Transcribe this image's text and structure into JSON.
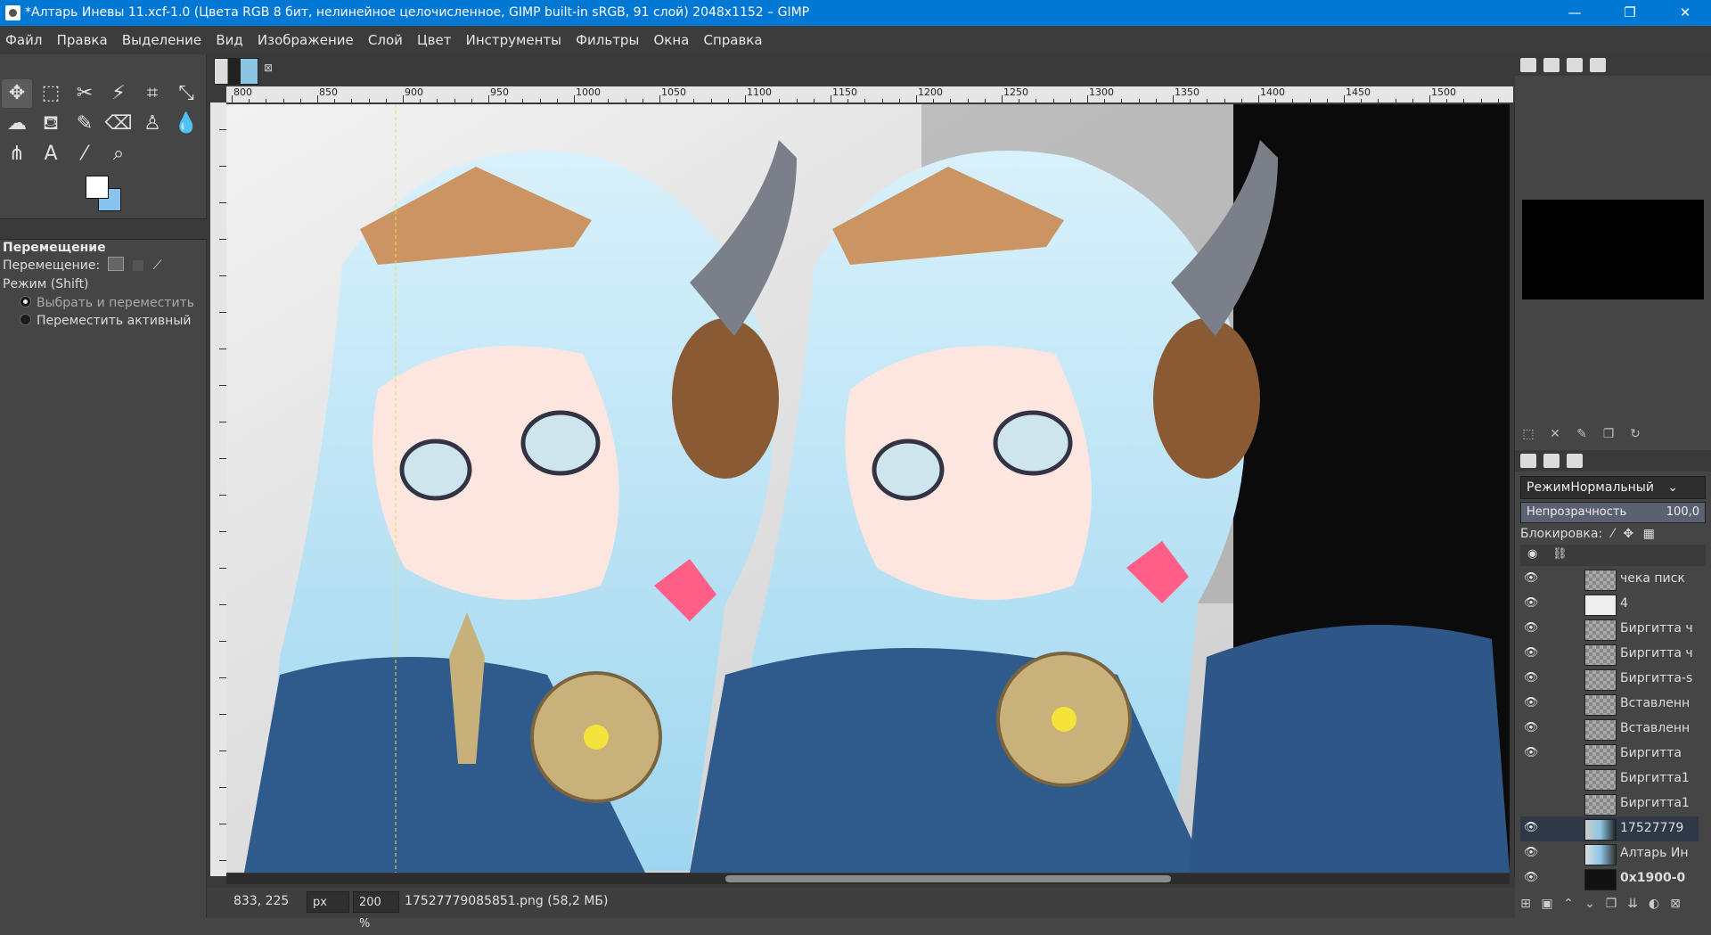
{
  "window": {
    "title": "*Алтарь Иневы 11.xcf-1.0 (Цвета RGB 8 бит, нелинейное целочисленное, GIMP built-in sRGB, 91 слой) 2048x1152 – GIMP",
    "minimize": "—",
    "restore": "❐",
    "close": "✕"
  },
  "menu": [
    "Файл",
    "Правка",
    "Выделение",
    "Вид",
    "Изображение",
    "Слой",
    "Цвет",
    "Инструменты",
    "Фильтры",
    "Окна",
    "Справка"
  ],
  "toolbox": {
    "tools": [
      {
        "name": "move-tool-icon",
        "glyph": "✥"
      },
      {
        "name": "rect-select-icon",
        "glyph": "⬚"
      },
      {
        "name": "scissors-select-icon",
        "glyph": "✂"
      },
      {
        "name": "fuzzy-select-icon",
        "glyph": "⚡"
      },
      {
        "name": "crop-icon",
        "glyph": "⌗"
      },
      {
        "name": "transform-icon",
        "glyph": "⤡"
      },
      {
        "name": "warp-icon",
        "glyph": "☁"
      },
      {
        "name": "bucket-fill-icon",
        "glyph": "⛾"
      },
      {
        "name": "paintbrush-icon",
        "glyph": "✎"
      },
      {
        "name": "eraser-icon",
        "glyph": "⌫"
      },
      {
        "name": "clone-icon",
        "glyph": "♙"
      },
      {
        "name": "smudge-icon",
        "glyph": "💧"
      },
      {
        "name": "paths-icon",
        "glyph": "⋔"
      },
      {
        "name": "text-tool-icon",
        "glyph": "A"
      },
      {
        "name": "color-picker-icon",
        "glyph": "⁄"
      },
      {
        "name": "zoom-icon",
        "glyph": "⌕"
      }
    ],
    "fg_color": "#ffffff",
    "bg_color": "#87c5f0"
  },
  "tool_options": {
    "title": "Перемещение",
    "move_label": "Перемещение:",
    "mode_label": "Режим (Shift)",
    "options": [
      "Выбрать и переместить",
      "Переместить активный"
    ]
  },
  "canvas": {
    "image_tab_close": "⊠",
    "ruler_labels": [
      "800",
      "850",
      "900",
      "950",
      "1000",
      "1050",
      "1100",
      "1150",
      "1200",
      "1250",
      "1300",
      "1350",
      "1400",
      "1450",
      "1500"
    ]
  },
  "statusbar": {
    "coords": "833, 225",
    "unit": "px",
    "zoom": "200 %",
    "file": "17527779085851.png (58,2 МБ)"
  },
  "layers_panel": {
    "mode_label": "Режим",
    "mode_value": "Нормальный",
    "opacity_label": "Непрозрачность",
    "opacity_value": "100,0",
    "lock_label": "Блокировка:",
    "layers": [
      {
        "name": "чека писк",
        "visible": true,
        "selected": false
      },
      {
        "name": "4",
        "visible": true,
        "selected": false
      },
      {
        "name": "Биргитта ч",
        "visible": true,
        "selected": false
      },
      {
        "name": "Биргитта ч",
        "visible": true,
        "selected": false
      },
      {
        "name": "Биргитта-s",
        "visible": true,
        "selected": false
      },
      {
        "name": "Вставленн",
        "visible": true,
        "selected": false
      },
      {
        "name": "Вставленн",
        "visible": true,
        "selected": false
      },
      {
        "name": "Биргитта",
        "visible": true,
        "selected": false
      },
      {
        "name": "Биргитта1",
        "visible": false,
        "selected": false
      },
      {
        "name": "Биргитта1",
        "visible": false,
        "selected": false
      },
      {
        "name": "17527779",
        "visible": true,
        "selected": true
      },
      {
        "name": "Алтарь Ин",
        "visible": true,
        "selected": false
      },
      {
        "name": "0x1900-0",
        "visible": true,
        "selected": false
      }
    ]
  }
}
